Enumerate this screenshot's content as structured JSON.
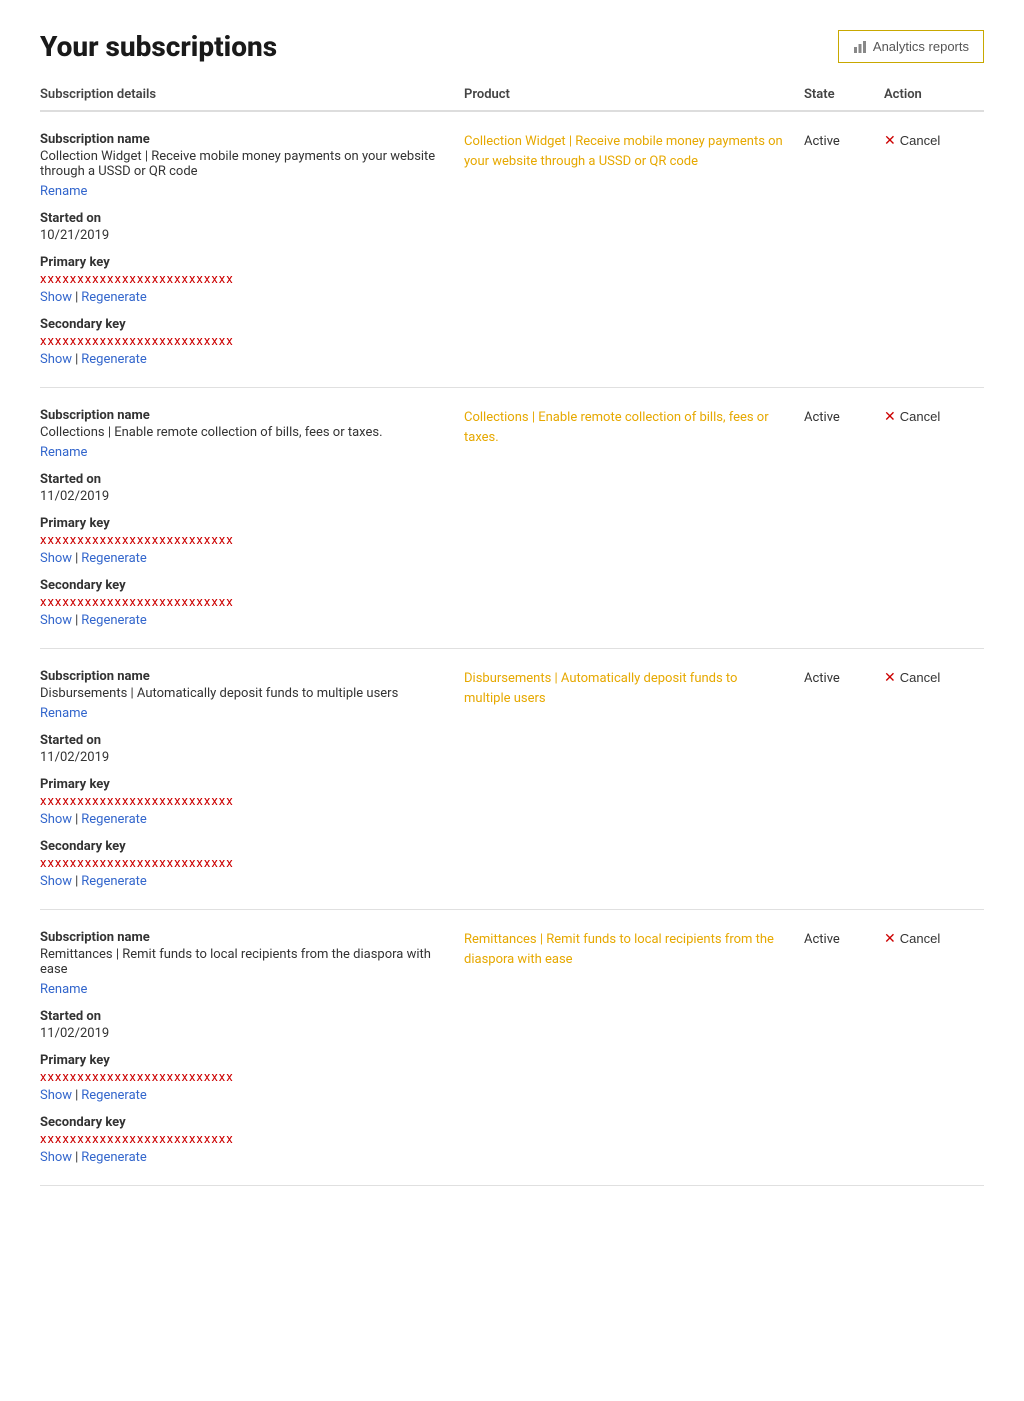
{
  "page": {
    "title": "Your subscriptions",
    "analytics_button": "Analytics reports"
  },
  "table": {
    "headers": [
      "Subscription details",
      "Product",
      "State",
      "Action"
    ],
    "subscriptions": [
      {
        "id": "sub-1",
        "name_label": "Subscription name",
        "name_value": "Collection Widget | Receive mobile money payments on your website through a USSD or QR code",
        "rename_label": "Rename",
        "started_label": "Started on",
        "started_value": "10/21/2019",
        "primary_key_label": "Primary key",
        "primary_key_masked": "xxxxxxxxxxxxxxxxxxxxxxxxxx",
        "show_label": "Show",
        "regenerate_label": "Regenerate",
        "secondary_key_label": "Secondary key",
        "secondary_key_masked": "xxxxxxxxxxxxxxxxxxxxxxxxxx",
        "product_link": "Collection Widget | Receive mobile money payments on your website through a USSD or QR code",
        "state": "Active",
        "cancel_label": "Cancel"
      },
      {
        "id": "sub-2",
        "name_label": "Subscription name",
        "name_value": "Collections | Enable remote collection of bills, fees or taxes.",
        "rename_label": "Rename",
        "started_label": "Started on",
        "started_value": "11/02/2019",
        "primary_key_label": "Primary key",
        "primary_key_masked": "xxxxxxxxxxxxxxxxxxxxxxxxxx",
        "show_label": "Show",
        "regenerate_label": "Regenerate",
        "secondary_key_label": "Secondary key",
        "secondary_key_masked": "xxxxxxxxxxxxxxxxxxxxxxxxxx",
        "product_link": "Collections | Enable remote collection of bills, fees or taxes.",
        "state": "Active",
        "cancel_label": "Cancel"
      },
      {
        "id": "sub-3",
        "name_label": "Subscription name",
        "name_value": "Disbursements | Automatically deposit funds to multiple users",
        "rename_label": "Rename",
        "started_label": "Started on",
        "started_value": "11/02/2019",
        "primary_key_label": "Primary key",
        "primary_key_masked": "xxxxxxxxxxxxxxxxxxxxxxxxxx",
        "show_label": "Show",
        "regenerate_label": "Regenerate",
        "secondary_key_label": "Secondary key",
        "secondary_key_masked": "xxxxxxxxxxxxxxxxxxxxxxxxxx",
        "product_link": "Disbursements | Automatically deposit funds to multiple users",
        "state": "Active",
        "cancel_label": "Cancel"
      },
      {
        "id": "sub-4",
        "name_label": "Subscription name",
        "name_value": "Remittances | Remit funds to local recipients from the diaspora with ease",
        "rename_label": "Rename",
        "started_label": "Started on",
        "started_value": "11/02/2019",
        "primary_key_label": "Primary key",
        "primary_key_masked": "xxxxxxxxxxxxxxxxxxxxxxxxxx",
        "show_label": "Show",
        "regenerate_label": "Regenerate",
        "secondary_key_label": "Secondary key",
        "secondary_key_masked": "xxxxxxxxxxxxxxxxxxxxxxxxxx",
        "product_link": "Remittances | Remit funds to local recipients from the diaspora with ease",
        "state": "Active",
        "cancel_label": "Cancel"
      }
    ]
  }
}
